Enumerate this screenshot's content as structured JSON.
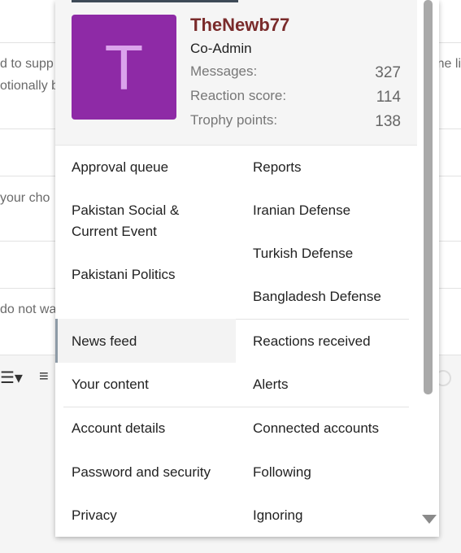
{
  "background": {
    "lines": [
      "d to supp",
      "otionally b",
      "your cho",
      "do not wa"
    ],
    "right_fragment": "ne li"
  },
  "user": {
    "avatar_letter": "T",
    "name": "TheNewb77",
    "role": "Co-Admin",
    "stats": [
      {
        "label": "Messages:",
        "value": "327"
      },
      {
        "label": "Reaction score:",
        "value": "114"
      },
      {
        "label": "Trophy points:",
        "value": "138"
      }
    ]
  },
  "links": {
    "approval_queue": "Approval queue",
    "reports": "Reports",
    "forum_pakistan_social": "Pakistan Social & Current Event",
    "forum_iranian_defense": "Iranian Defense",
    "forum_turkish_defense": "Turkish Defense",
    "forum_pakistani_politics": "Pakistani Politics",
    "forum_bangladesh_defense": "Bangladesh Defense",
    "news_feed": "News feed",
    "reactions_received": "Reactions received",
    "your_content": "Your content",
    "alerts": "Alerts",
    "account_details": "Account details",
    "connected_accounts": "Connected accounts",
    "password_security": "Password and security",
    "following": "Following",
    "privacy": "Privacy",
    "ignoring": "Ignoring"
  },
  "colors": {
    "avatar_bg": "#8e2aa6",
    "username": "#7a2b2b"
  }
}
